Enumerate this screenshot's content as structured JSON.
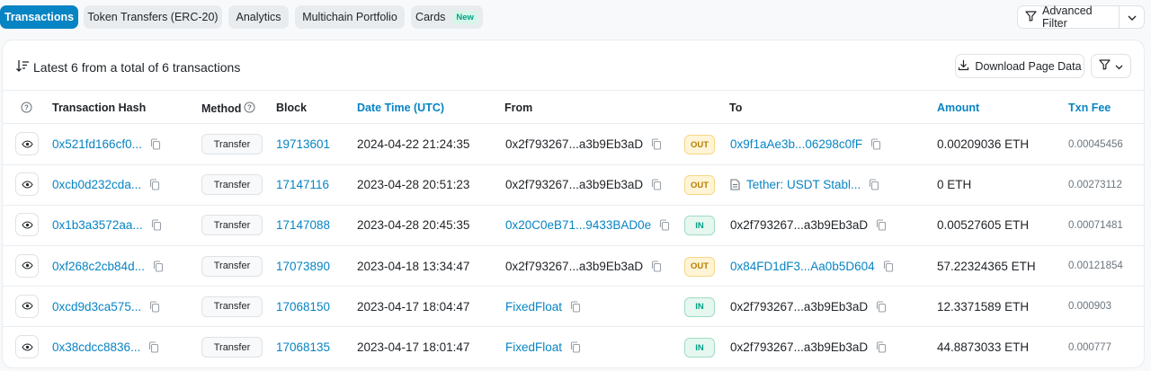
{
  "tabs": [
    {
      "label": "Transactions",
      "active": true
    },
    {
      "label": "Token Transfers (ERC-20)",
      "active": false
    },
    {
      "label": "Analytics",
      "active": false
    },
    {
      "label": "Multichain Portfolio",
      "active": false
    },
    {
      "label": "Cards",
      "active": false,
      "badge": "New"
    }
  ],
  "advanced_filter_label": "Advanced Filter",
  "summary": "Latest 6 from a total of 6 transactions",
  "download_label": "Download Page Data",
  "columns": {
    "hash": "Transaction Hash",
    "method": "Method",
    "block": "Block",
    "datetime": "Date Time (UTC)",
    "from": "From",
    "to": "To",
    "amount": "Amount",
    "fee": "Txn Fee"
  },
  "rows": [
    {
      "hash": "0x521fd166cf0...",
      "method": "Transfer",
      "block": "19713601",
      "datetime": "2024-04-22 21:24:35",
      "from": "0x2f793267...a3b9Eb3aD",
      "from_link": false,
      "direction": "OUT",
      "to": "0x9f1aAe3b...06298c0fF",
      "to_link": true,
      "to_contract": false,
      "amount": "0.00209036 ETH",
      "fee": "0.00045456"
    },
    {
      "hash": "0xcb0d232cda...",
      "method": "Transfer",
      "block": "17147116",
      "datetime": "2023-04-28 20:51:23",
      "from": "0x2f793267...a3b9Eb3aD",
      "from_link": false,
      "direction": "OUT",
      "to": "Tether: USDT Stabl...",
      "to_link": true,
      "to_contract": true,
      "amount": "0 ETH",
      "fee": "0.00273112"
    },
    {
      "hash": "0x1b3a3572aa...",
      "method": "Transfer",
      "block": "17147088",
      "datetime": "2023-04-28 20:45:35",
      "from": "0x20C0eB71...9433BAD0e",
      "from_link": true,
      "direction": "IN",
      "to": "0x2f793267...a3b9Eb3aD",
      "to_link": false,
      "to_contract": false,
      "amount": "0.00527605 ETH",
      "fee": "0.00071481"
    },
    {
      "hash": "0xf268c2cb84d...",
      "method": "Transfer",
      "block": "17073890",
      "datetime": "2023-04-18 13:34:47",
      "from": "0x2f793267...a3b9Eb3aD",
      "from_link": false,
      "direction": "OUT",
      "to": "0x84FD1dF3...Aa0b5D604",
      "to_link": true,
      "to_contract": false,
      "amount": "57.22324365 ETH",
      "fee": "0.00121854"
    },
    {
      "hash": "0xcd9d3ca575...",
      "method": "Transfer",
      "block": "17068150",
      "datetime": "2023-04-17 18:04:47",
      "from": "FixedFloat",
      "from_link": true,
      "direction": "IN",
      "to": "0x2f793267...a3b9Eb3aD",
      "to_link": false,
      "to_contract": false,
      "amount": "12.3371589 ETH",
      "fee": "0.000903"
    },
    {
      "hash": "0x38cdcc8836...",
      "method": "Transfer",
      "block": "17068135",
      "datetime": "2023-04-17 18:01:47",
      "from": "FixedFloat",
      "from_link": true,
      "direction": "IN",
      "to": "0x2f793267...a3b9Eb3aD",
      "to_link": false,
      "to_contract": false,
      "amount": "44.8873033 ETH",
      "fee": "0.000777"
    }
  ],
  "colors": {
    "accent": "#0784c3",
    "out": "#b47d00",
    "in": "#00a186"
  },
  "icons": {
    "eye": "eye-icon",
    "copy": "copy-icon",
    "filter": "filter-icon",
    "download": "download-icon",
    "sort": "sort-icon",
    "help": "help-icon"
  }
}
